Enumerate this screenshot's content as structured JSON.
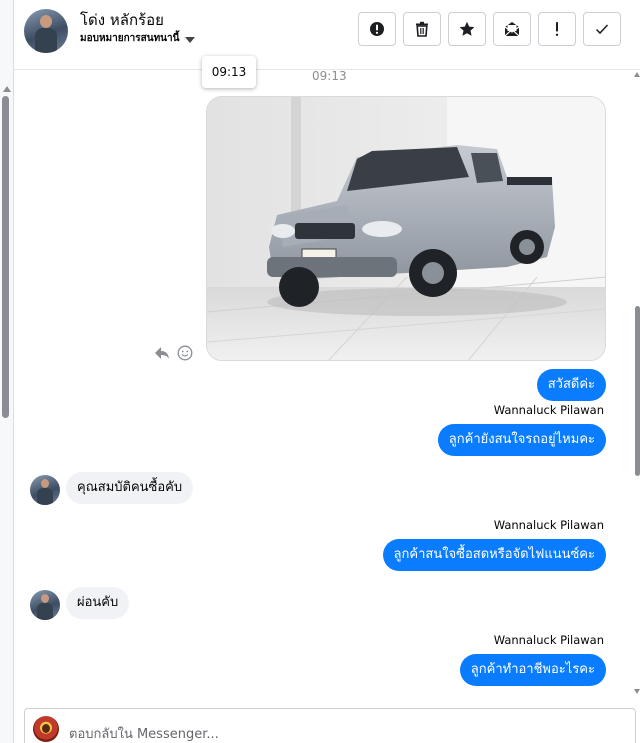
{
  "header": {
    "name": "โด่ง หลักร้อย",
    "assign_label": "มอบหมายการสนทนานี้",
    "actions": [
      {
        "name": "spam",
        "icon": "alert-circle-icon"
      },
      {
        "name": "delete",
        "icon": "trash-icon"
      },
      {
        "name": "star",
        "icon": "star-icon"
      },
      {
        "name": "mark-unread",
        "icon": "envelope-icon"
      },
      {
        "name": "important",
        "icon": "exclamation-icon"
      },
      {
        "name": "done",
        "icon": "check-icon"
      }
    ]
  },
  "tooltip": {
    "text": "09:13"
  },
  "conversation": {
    "timestamp": "09:13",
    "image_message": {
      "alt": "silver pickup truck photo"
    },
    "messages": [
      {
        "direction": "out",
        "text": "สวัสดีค่ะ"
      },
      {
        "direction": "out",
        "sender": "Wannaluck Pilawan",
        "text": "ลูกค้ายังสนใจรถอยู่ไหมคะ"
      },
      {
        "direction": "in",
        "text": "คุณสมบัติคนซื้อคับ"
      },
      {
        "direction": "out",
        "sender": "Wannaluck Pilawan",
        "text": "ลูกค้าสนใจซื้อสดหรือจัดไฟแนนซ์คะ"
      },
      {
        "direction": "in",
        "text": "ผ่อนคับ"
      },
      {
        "direction": "out",
        "sender": "Wannaluck Pilawan",
        "text": "ลูกค้าทำอาชีพอะไรคะ"
      }
    ]
  },
  "composer": {
    "placeholder": "ตอบกลับใน Messenger..."
  },
  "colors": {
    "outgoing_bubble": "#0a7cff",
    "incoming_bubble": "#f0f2f5"
  }
}
